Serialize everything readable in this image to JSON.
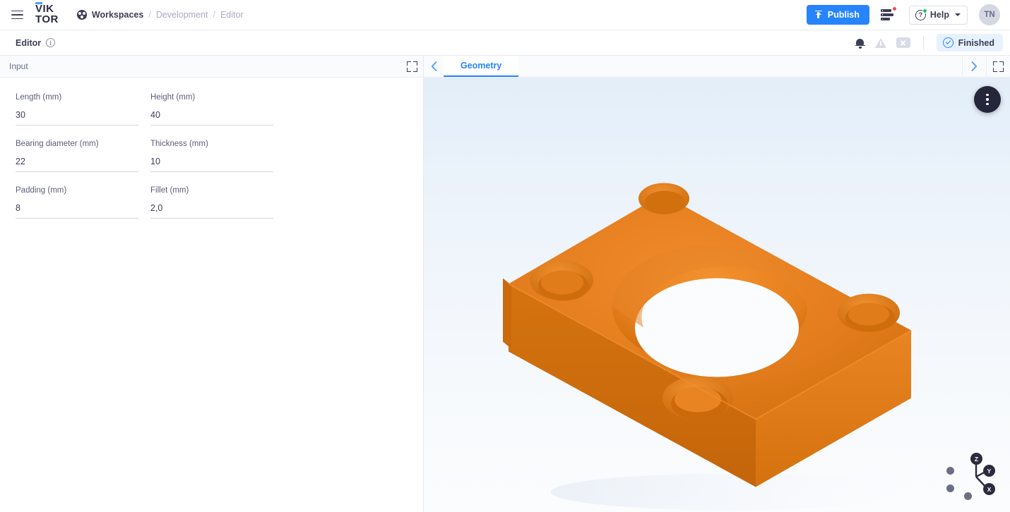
{
  "topbar": {
    "menu_icon": "hamburger-icon",
    "logo_line1": "VIK",
    "logo_line2": "TOR",
    "breadcrumb": [
      {
        "label": "Workspaces",
        "dim": false
      },
      {
        "label": "Development",
        "dim": true
      },
      {
        "label": "Editor",
        "dim": true
      }
    ],
    "separator": "/",
    "publish_label": "Publish",
    "publish_icon": "upload-icon",
    "publish_color": "#2684ff",
    "jobs_icon": "job-list-icon",
    "jobs_badge_color": "#ff4757",
    "help_label": "Help",
    "help_icon": "question-circle-icon",
    "help_badge_color": "#22c55e",
    "help_caret": "chevron-down-icon",
    "avatar_initials": "TN"
  },
  "editorbar": {
    "title": "Editor",
    "info_icon": "info-icon",
    "info_glyph": "i",
    "bell_icon": "bell-icon",
    "warning_icon": "warning-triangle-icon",
    "stop_icon": "cancel-box-icon",
    "status_label": "Finished",
    "status_icon": "check-circle-icon",
    "status_bg": "#e8f2ff",
    "status_accent": "#2684ff"
  },
  "left_panel": {
    "header_label": "Input",
    "expand_icon": "expand-icon",
    "fields": [
      {
        "label": "Length (mm)",
        "value": "30",
        "placeholder": ""
      },
      {
        "label": "Height (mm)",
        "value": "40",
        "placeholder": ""
      },
      {
        "label": "Bearing diameter (mm)",
        "value": "22",
        "placeholder": ""
      },
      {
        "label": "Thickness (mm)",
        "value": "10",
        "placeholder": ""
      },
      {
        "label": "Padding (mm)",
        "value": "8",
        "placeholder": ""
      },
      {
        "label": "Fillet (mm)",
        "value": "2,0",
        "placeholder": ""
      }
    ]
  },
  "right_panel": {
    "prev_icon": "chevron-left-icon",
    "next_icon": "chevron-right-icon",
    "expand_icon": "expand-icon",
    "tabs": [
      {
        "label": "Geometry",
        "active": true
      }
    ],
    "fab_icon": "more-vertical-icon",
    "model_color": "#e07b1d",
    "model_color_top": "#e8852a",
    "model_color_side": "#cf6f15",
    "background_top": "#e3eef9",
    "background_bottom": "#fbfcfe",
    "gizmo": {
      "axes": [
        {
          "label": "Z"
        },
        {
          "label": "Y"
        },
        {
          "label": "X"
        }
      ],
      "unlabeled_count": 3
    }
  }
}
